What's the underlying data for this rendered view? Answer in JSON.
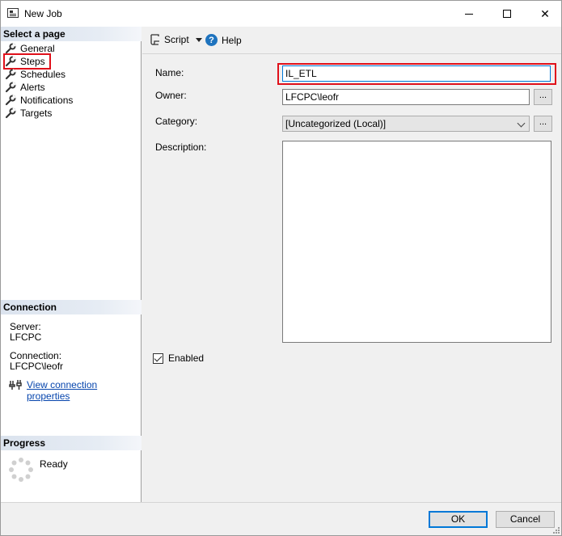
{
  "window": {
    "title": "New Job",
    "controls": {
      "minimize": "minimize",
      "maximize": "maximize",
      "close": "✕"
    }
  },
  "sidebar": {
    "select_page_header": "Select a page",
    "items": [
      {
        "label": "General",
        "icon": "wrench-icon"
      },
      {
        "label": "Steps",
        "icon": "wrench-icon",
        "highlighted": true
      },
      {
        "label": "Schedules",
        "icon": "wrench-icon"
      },
      {
        "label": "Alerts",
        "icon": "wrench-icon"
      },
      {
        "label": "Notifications",
        "icon": "wrench-icon"
      },
      {
        "label": "Targets",
        "icon": "wrench-icon"
      }
    ],
    "connection_header": "Connection",
    "server_label": "Server:",
    "server_value": "LFCPC",
    "connection_label": "Connection:",
    "connection_value": "LFCPC\\leofr",
    "view_connection_link": "View connection properties",
    "progress_header": "Progress",
    "progress_status": "Ready"
  },
  "toolbar": {
    "script_label": "Script",
    "help_label": "Help"
  },
  "form": {
    "name_label": "Name:",
    "name_value": "IL_ETL",
    "owner_label": "Owner:",
    "owner_value": "LFCPC\\leofr",
    "owner_browse": "...",
    "category_label": "Category:",
    "category_value": "[Uncategorized (Local)]",
    "category_browse": "...",
    "description_label": "Description:",
    "description_value": "",
    "enabled_label": "Enabled",
    "enabled_checked": true
  },
  "footer": {
    "ok_label": "OK",
    "cancel_label": "Cancel"
  },
  "colors": {
    "highlight": "#e0101a",
    "focus_blue": "#0078d7",
    "link": "#0645ad"
  }
}
